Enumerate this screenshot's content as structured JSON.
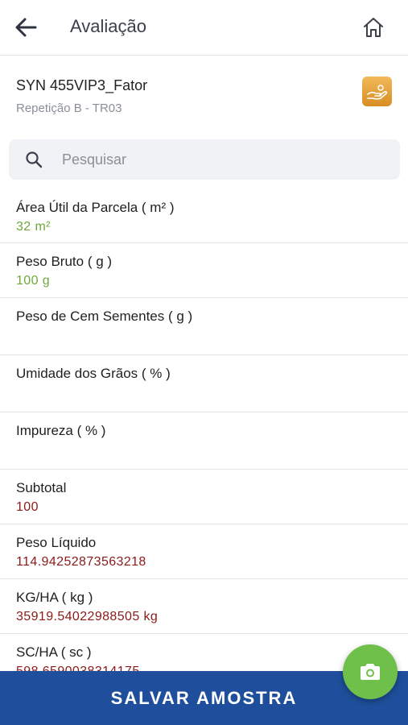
{
  "header": {
    "title": "Avaliação"
  },
  "sample": {
    "name": "SYN 455VIP3_Fator",
    "subtitle": "Repetição B - TR03"
  },
  "search": {
    "placeholder": "Pesquisar"
  },
  "fields": [
    {
      "label": "Área Útil da Parcela ( m² )",
      "value": "32 m²",
      "value_color": "green"
    },
    {
      "label": "Peso Bruto ( g )",
      "value": "100 g",
      "value_color": "green"
    },
    {
      "label": "Peso de Cem Sementes ( g )",
      "value": ""
    },
    {
      "label": "Umidade dos Grãos ( % )",
      "value": ""
    },
    {
      "label": "Impureza ( % )",
      "value": ""
    },
    {
      "label": "Subtotal",
      "value": "100",
      "value_color": "red"
    },
    {
      "label": "Peso Líquido",
      "value": "114.94252873563218",
      "value_color": "red"
    },
    {
      "label": "KG/HA ( kg )",
      "value": "35919.54022988505 kg",
      "value_color": "red"
    },
    {
      "label": "SC/HA ( sc )",
      "value": "598.6590038314175",
      "value_color": "red"
    }
  ],
  "footer": {
    "save_label": "SALVAR AMOSTRA"
  },
  "colors": {
    "primary": "#1f4f9c",
    "fab": "#6ec04a",
    "value_green": "#6fa83a",
    "value_red": "#8b1a1a",
    "sample_icon": "#e3a13e"
  },
  "icons": {
    "back": "arrow-left-icon",
    "home": "home-icon",
    "sample": "hand-icon",
    "search": "search-icon",
    "camera": "camera-icon"
  }
}
